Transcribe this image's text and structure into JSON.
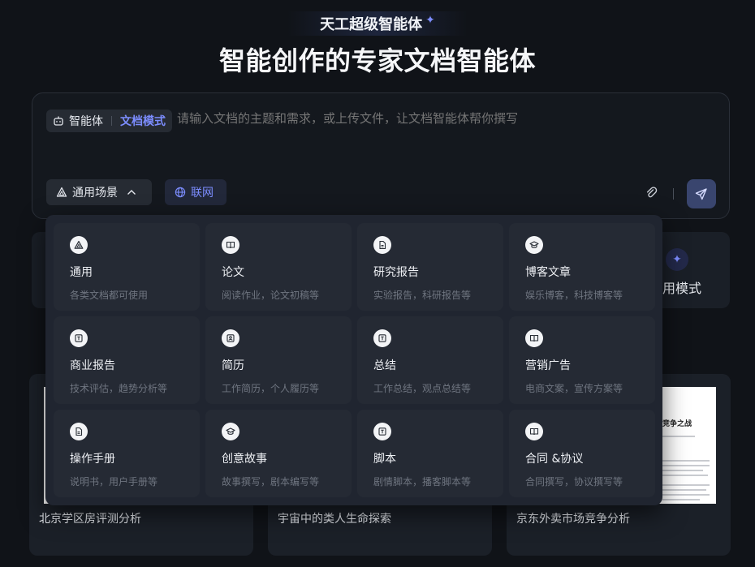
{
  "header": {
    "brand": "天工超级智能体",
    "title": "智能创作的专家文档智能体"
  },
  "prompt": {
    "agent_label": "智能体",
    "mode_label": "文档模式",
    "placeholder": "请输入文档的主题和需求，或上传文件，让文档智能体帮你撰写",
    "scene_button": "通用场景",
    "network_button": "联网"
  },
  "background": {
    "mode_partial_label": "用模式"
  },
  "dropdown": {
    "items": [
      {
        "title": "通用",
        "desc": "各类文档都可使用",
        "icon": "triangle-icon"
      },
      {
        "title": "论文",
        "desc": "阅读作业，论文初稿等",
        "icon": "book-icon"
      },
      {
        "title": "研究报告",
        "desc": "实验报告，科研报告等",
        "icon": "document-icon"
      },
      {
        "title": "博客文章",
        "desc": "娱乐博客，科技博客等",
        "icon": "graduation-cap-icon"
      },
      {
        "title": "商业报告",
        "desc": "技术评估，趋势分析等",
        "icon": "tablet-icon"
      },
      {
        "title": "简历",
        "desc": "工作简历，个人履历等",
        "icon": "profile-icon"
      },
      {
        "title": "总结",
        "desc": "工作总结，观点总结等",
        "icon": "tablet-icon"
      },
      {
        "title": "营销广告",
        "desc": "电商文案，宣传方案等",
        "icon": "book-icon"
      },
      {
        "title": "操作手册",
        "desc": "说明书，用户手册等",
        "icon": "document-icon"
      },
      {
        "title": "创意故事",
        "desc": "故事撰写，剧本编写等",
        "icon": "graduation-cap-icon"
      },
      {
        "title": "脚本",
        "desc": "剧情脚本，播客脚本等",
        "icon": "tablet-icon"
      },
      {
        "title": "合同 &协议",
        "desc": "合同撰写，协议撰写等",
        "icon": "book-icon"
      }
    ]
  },
  "examples": [
    {
      "caption": "北京学区房评测分析"
    },
    {
      "caption": "宇宙中的类人生命探索"
    },
    {
      "caption": "京东外卖市场竞争分析",
      "doc_title": "竞争之战"
    }
  ],
  "colors": {
    "background": "#101318",
    "accent": "#7c8dff",
    "panel": "#202530"
  }
}
